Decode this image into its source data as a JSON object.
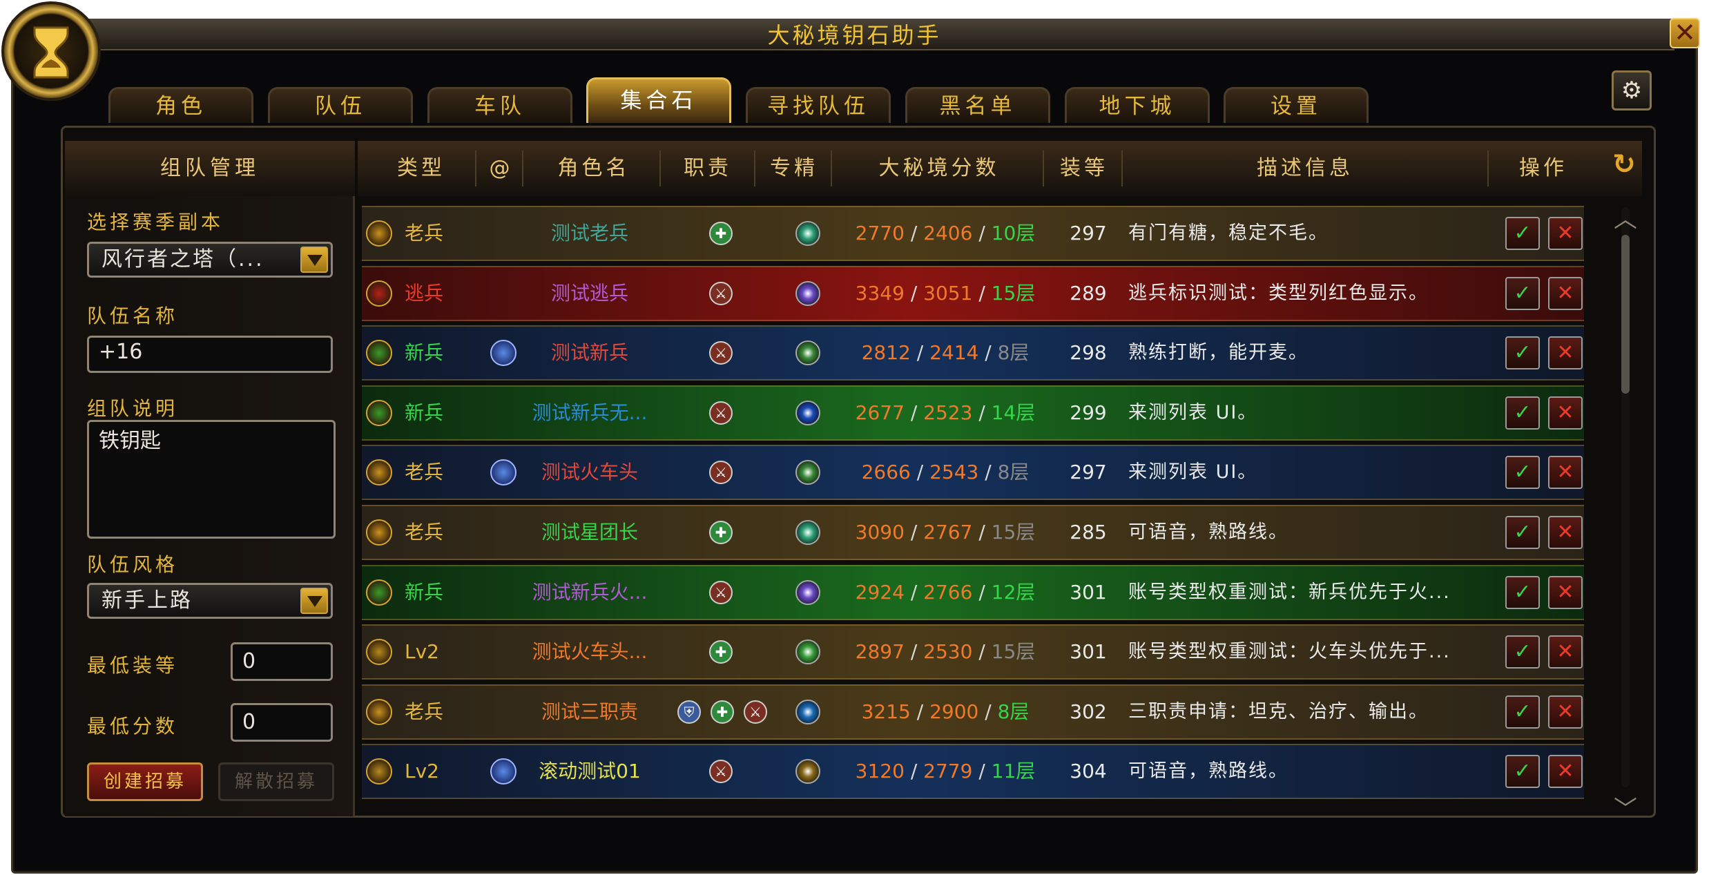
{
  "window": {
    "title": "大秘境钥石助手"
  },
  "tabs": [
    {
      "label": "角色",
      "active": false
    },
    {
      "label": "队伍",
      "active": false
    },
    {
      "label": "车队",
      "active": false
    },
    {
      "label": "集合石",
      "active": true
    },
    {
      "label": "寻找队伍",
      "active": false
    },
    {
      "label": "黑名单",
      "active": false
    },
    {
      "label": "地下城",
      "active": false
    },
    {
      "label": "设置",
      "active": false
    }
  ],
  "sidebar": {
    "title": "组队管理",
    "season_label": "选择赛季副本",
    "season_value": "风行者之塔（...",
    "team_name_label": "队伍名称",
    "team_name_value": "+16",
    "desc_label": "组队说明",
    "desc_value": "铁钥匙",
    "style_label": "队伍风格",
    "style_value": "新手上路",
    "min_ilvl_label": "最低装等",
    "min_ilvl_value": "0",
    "min_score_label": "最低分数",
    "min_score_value": "0",
    "create_label": "创建招募",
    "dissolve_label": "解散招募"
  },
  "table": {
    "headers": {
      "type": "类型",
      "at": "@",
      "name": "角色名",
      "role": "职责",
      "spec": "专精",
      "score": "大秘境分数",
      "ilvl": "装等",
      "desc": "描述信息",
      "op": "操作"
    },
    "rows": [
      {
        "type": "老兵",
        "type_color": "#e3b63b",
        "badge": "#c9911e",
        "at": false,
        "name": "测试老兵",
        "name_color": "#3fa79a",
        "roles": [
          "heal"
        ],
        "spec": "#2fa37a",
        "s1": "2770",
        "s2": "2406",
        "lvl": "10层",
        "lvl_color": "#34d64a",
        "ilvl": "297",
        "desc": "有门有糖，稳定不毛。",
        "bg": "linear-gradient(90deg,#2a2318,#4a3a18 45%,#2a2318)"
      },
      {
        "type": "逃兵",
        "type_color": "#ea3a2a",
        "badge": "#b5201a",
        "at": false,
        "name": "测试逃兵",
        "name_color": "#b35ad6",
        "roles": [
          "dps"
        ],
        "spec": "#6a4ac6",
        "s1": "3349",
        "s2": "3051",
        "lvl": "15层",
        "lvl_color": "#34d64a",
        "ilvl": "289",
        "desc": "逃兵标识测试：类型列红色显示。",
        "bg": "linear-gradient(90deg,#3a0c0a,#8a1410 45%,#3a0c0a)"
      },
      {
        "type": "新兵",
        "type_color": "#34d64a",
        "badge": "#3a9a2a",
        "at": true,
        "name": "测试新兵",
        "name_color": "#e04a3a",
        "roles": [
          "dps"
        ],
        "spec": "#3a8a3a",
        "s1": "2812",
        "s2": "2414",
        "lvl": "8层",
        "lvl_color": "#8a8a8a",
        "ilvl": "298",
        "desc": "熟练打断，能开麦。",
        "bg": "linear-gradient(90deg,#10182a,#14305a 45%,#10182a)"
      },
      {
        "type": "新兵",
        "type_color": "#34d64a",
        "badge": "#3a9a2a",
        "at": false,
        "name": "测试新兵无...",
        "name_color": "#2a8ad6",
        "roles": [
          "dps"
        ],
        "spec": "#1a4ab6",
        "s1": "2677",
        "s2": "2523",
        "lvl": "14层",
        "lvl_color": "#34d64a",
        "ilvl": "299",
        "desc": "来测列表 UI。",
        "bg": "linear-gradient(90deg,#0c2a0e,#1a6a1e 45%,#0c2a0e)"
      },
      {
        "type": "老兵",
        "type_color": "#e3b63b",
        "badge": "#c9911e",
        "at": true,
        "name": "测试火车头",
        "name_color": "#e04a3a",
        "roles": [
          "dps"
        ],
        "spec": "#3a8a3a",
        "s1": "2666",
        "s2": "2543",
        "lvl": "8层",
        "lvl_color": "#8a8a8a",
        "ilvl": "297",
        "desc": "来测列表 UI。",
        "bg": "linear-gradient(90deg,#10182a,#14305a 45%,#10182a)"
      },
      {
        "type": "老兵",
        "type_color": "#e3b63b",
        "badge": "#c9911e",
        "at": false,
        "name": "测试星团长",
        "name_color": "#34d64a",
        "roles": [
          "heal"
        ],
        "spec": "#2fa37a",
        "s1": "3090",
        "s2": "2767",
        "lvl": "15层",
        "lvl_color": "#8a8a8a",
        "ilvl": "285",
        "desc": "可语音，熟路线。",
        "bg": "linear-gradient(90deg,#2a2318,#4a3a18 45%,#2a2318)"
      },
      {
        "type": "新兵",
        "type_color": "#34d64a",
        "badge": "#3a9a2a",
        "at": false,
        "name": "测试新兵火...",
        "name_color": "#b35ad6",
        "roles": [
          "dps"
        ],
        "spec": "#6a4ac6",
        "s1": "2924",
        "s2": "2766",
        "lvl": "12层",
        "lvl_color": "#34d64a",
        "ilvl": "301",
        "desc": "账号类型权重测试：新兵优先于火...",
        "bg": "linear-gradient(90deg,#0c2a0e,#1a6a1e 45%,#0c2a0e)"
      },
      {
        "type": "Lv2",
        "type_color": "#e3b63b",
        "badge": "#b58a1e",
        "at": false,
        "name": "测试火车头...",
        "name_color": "#f07a2a",
        "roles": [
          "heal"
        ],
        "spec": "#3aa03a",
        "s1": "2897",
        "s2": "2530",
        "lvl": "15层",
        "lvl_color": "#8a8a8a",
        "ilvl": "301",
        "desc": "账号类型权重测试：火车头优先于...",
        "bg": "linear-gradient(90deg,#2a2318,#4a3a18 45%,#2a2318)"
      },
      {
        "type": "老兵",
        "type_color": "#e3b63b",
        "badge": "#c9911e",
        "at": false,
        "name": "测试三职责",
        "name_color": "#f07a2a",
        "roles": [
          "tank",
          "heal",
          "dps"
        ],
        "spec": "#1a6ab6",
        "s1": "3215",
        "s2": "2900",
        "lvl": "8层",
        "lvl_color": "#34d64a",
        "ilvl": "302",
        "desc": "三职责申请：坦克、治疗、输出。",
        "bg": "linear-gradient(90deg,#2a2318,#4a3a18 45%,#2a2318)"
      },
      {
        "type": "Lv2",
        "type_color": "#e3b63b",
        "badge": "#b58a1e",
        "at": true,
        "name": "滚动测试01",
        "name_color": "#e6e04a",
        "roles": [
          "dps"
        ],
        "spec": "#8a6a1a",
        "s1": "3120",
        "s2": "2779",
        "lvl": "11层",
        "lvl_color": "#34d64a",
        "ilvl": "304",
        "desc": "可语音，熟路线。",
        "bg": "linear-gradient(90deg,#10182a,#14305a 45%,#10182a)"
      }
    ]
  },
  "colors": {
    "gold": "#e3b63b",
    "score_orange": "#f07a2a",
    "score_sep": "#d8d8d8"
  }
}
